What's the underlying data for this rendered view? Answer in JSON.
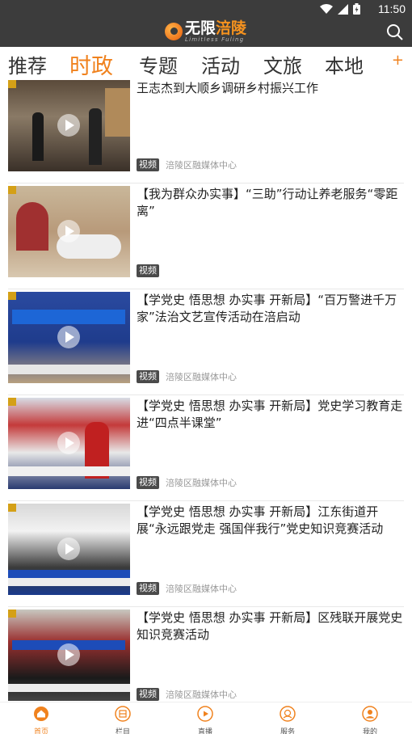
{
  "status_bar": {
    "time": "11:50"
  },
  "header": {
    "logo_cn_prefix": "无限",
    "logo_cn_accent": "涪陵",
    "logo_en": "Limitless Fuling"
  },
  "tabs": [
    {
      "label": "推荐"
    },
    {
      "label": "时政"
    },
    {
      "label": "专题"
    },
    {
      "label": "活动"
    },
    {
      "label": "文旅"
    },
    {
      "label": "本地"
    }
  ],
  "tab_add": "+",
  "news": [
    {
      "title": "王志杰到大顺乡调研乡村振兴工作",
      "badge": "视频",
      "source": "涪陵区融媒体中心"
    },
    {
      "title": "【我为群众办实事】“三助”行动让养老服务“零距离”",
      "badge": "视频",
      "source": ""
    },
    {
      "title": "【学党史 悟思想 办实事 开新局】“百万警进千万家”法治文艺宣传活动在涪启动",
      "badge": "视频",
      "source": "涪陵区融媒体中心"
    },
    {
      "title": "【学党史 悟思想 办实事 开新局】党史学习教育走进“四点半课堂”",
      "badge": "视频",
      "source": "涪陵区融媒体中心"
    },
    {
      "title": "【学党史 悟思想 办实事 开新局】江东街道开展“永远跟党走 强国伴我行”党史知识竞赛活动",
      "badge": "视频",
      "source": "涪陵区融媒体中心"
    },
    {
      "title": "【学党史 悟思想 办实事 开新局】区残联开展党史知识竞赛活动",
      "badge": "视频",
      "source": "涪陵区融媒体中心"
    }
  ],
  "bottom_nav": [
    {
      "label": "首页",
      "icon": "home-icon"
    },
    {
      "label": "栏目",
      "icon": "columns-icon"
    },
    {
      "label": "直播",
      "icon": "live-icon"
    },
    {
      "label": "服务",
      "icon": "service-icon"
    },
    {
      "label": "我的",
      "icon": "profile-icon"
    }
  ],
  "colors": {
    "accent": "#f0821e",
    "header_bg": "#3c3c3c"
  }
}
